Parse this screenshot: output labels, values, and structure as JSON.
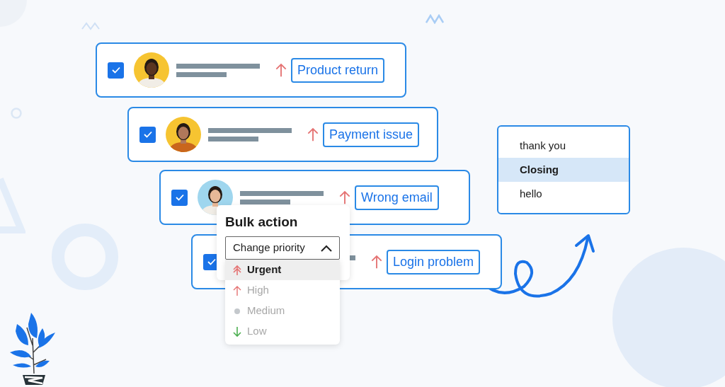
{
  "tickets": [
    {
      "checked": true,
      "kind": "high",
      "tag": "Product return"
    },
    {
      "checked": true,
      "kind": "high",
      "tag": "Payment issue"
    },
    {
      "checked": true,
      "kind": "high",
      "tag": "Wrong email"
    },
    {
      "checked": true,
      "kind": "high",
      "tag": "Login problem"
    }
  ],
  "bulk_action": {
    "title": "Bulk action",
    "select": {
      "value": "Change priority",
      "expanded": true
    },
    "options": [
      {
        "kind": "urgent",
        "label": "Urgent",
        "selected": true
      },
      {
        "kind": "high",
        "label": "High",
        "selected": false
      },
      {
        "kind": "medium",
        "label": "Medium",
        "selected": false
      },
      {
        "kind": "low",
        "label": "Low",
        "selected": false
      }
    ]
  },
  "snippets": [
    {
      "label": "thank you",
      "selected": false
    },
    {
      "label": "Closing",
      "selected": true
    },
    {
      "label": "hello",
      "selected": false
    }
  ]
}
